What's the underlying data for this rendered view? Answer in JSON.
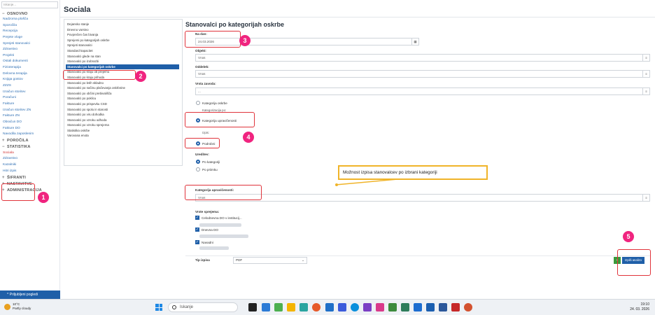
{
  "sidebar": {
    "search_placeholder": "Iskanje...",
    "groups": {
      "osnovno": "OSNOVNO",
      "porocila": "POROČILA",
      "statistika": "STATISTIKA",
      "sifranti": "ŠIFRANTI",
      "nastavitve": "NASTAVITVE",
      "administracija": "ADMINISTRACIJA"
    },
    "osnovno_items": [
      "Nadzorna plošča",
      "Sporočila",
      "Recepcija",
      "Prejete vloge",
      "Sprejeti stanovalci",
      "Zdravstvo",
      "Projekti",
      "Ostali dokumenti",
      "Fizioterapija",
      "Delovna terapija",
      "Knjiga gostov",
      "ZZZS",
      "Izračun storitev",
      "Poračuni",
      "Fakture",
      "Izračun storitev ZN",
      "Fakture ZN",
      "Obračun DO",
      "Fakture DO",
      "Navodila zaposlenim"
    ],
    "statistika_items": [
      "Sociala",
      "Zdravstvo",
      "Kazalniki",
      "Hitri izpis"
    ],
    "bottom_button": "Priljubljeni pogledi"
  },
  "page": {
    "title": "Sociala"
  },
  "reports": [
    "Dejansko stanje",
    "Dnevno varstvo",
    "Povprečen čas bivanja",
    "Sprejemi po kategorijah oskrbe",
    "Sprejeti stanovalci",
    "Standard kapacitet",
    "Stanovalci glede na stan",
    "Stanovalci po izobrazbi",
    "Stanovalci po kategorijah oskrbe",
    "Stanovalci po kraju ob prejemu",
    "Stanovalci po kraju prihoda",
    "Stanovalci po letih skladno",
    "Stanovalci po načinu plačevanja oskrbnine",
    "Stanovalci po občini prebivališča",
    "Stanovalci po poklicu",
    "Stanovalci po prispevku CSD",
    "Stanovalci po spolu in starosti",
    "Stanovalci po viru dohodka",
    "Stanovalci po vzroku odhoda",
    "Stanovalci po vzroku sprejema",
    "Statistika oskrbe",
    "Varovana enota"
  ],
  "form": {
    "title": "Stanovalci po kategorijah oskrbe",
    "na_dan_label": "Na dan:",
    "na_dan_value": "24.03.2026",
    "oddelek_label": "Objekt:",
    "oddelek_value": "Vnos",
    "odsek_label": "Oddelek:",
    "odsek_value": "Vnos",
    "vrsta_label": "Vrsta zavoda:",
    "vrsta_value": "...",
    "razvrstitev_options": [
      "Kategorija oskrbe",
      "Kategorija upravičenosti"
    ],
    "razvrstitev_label": "Kategorizacija po:",
    "izpis_label": "Izpis:",
    "izpis_options": [
      "Podrobni"
    ],
    "ureditev_label": "Ureditev:",
    "ureditev_options": [
      "Po kategoriji",
      "Po priimku"
    ],
    "kat_upr_label": "Kategorija upravičenosti:",
    "kat_upr_value": "Vnos",
    "vrste_label": "Vrste sprejema:",
    "vrste_options": [
      "Celodnevna DO v institucij...",
      "Dnevna DO",
      "Navadni"
    ],
    "tip_label": "Tip izpisa",
    "tip_value": "PDF",
    "print_button": "Izpiši analizo"
  },
  "annotations": {
    "n1": "1",
    "n2": "2",
    "n3": "3",
    "n4": "4",
    "n5": "5",
    "callout": "Možnost izpisa stanovalcev po izbrani kategoriji"
  },
  "taskbar": {
    "weather_temp": "10°C",
    "weather_desc": "Partly cloudy",
    "search_placeholder": "Iskanje",
    "time": "19:10",
    "date": "24. 03. 2026"
  },
  "colors": {
    "accent": "#1f5fa8",
    "annotation": "#e0333b",
    "badge": "#f0247f",
    "callout_border": "#f0b429"
  }
}
